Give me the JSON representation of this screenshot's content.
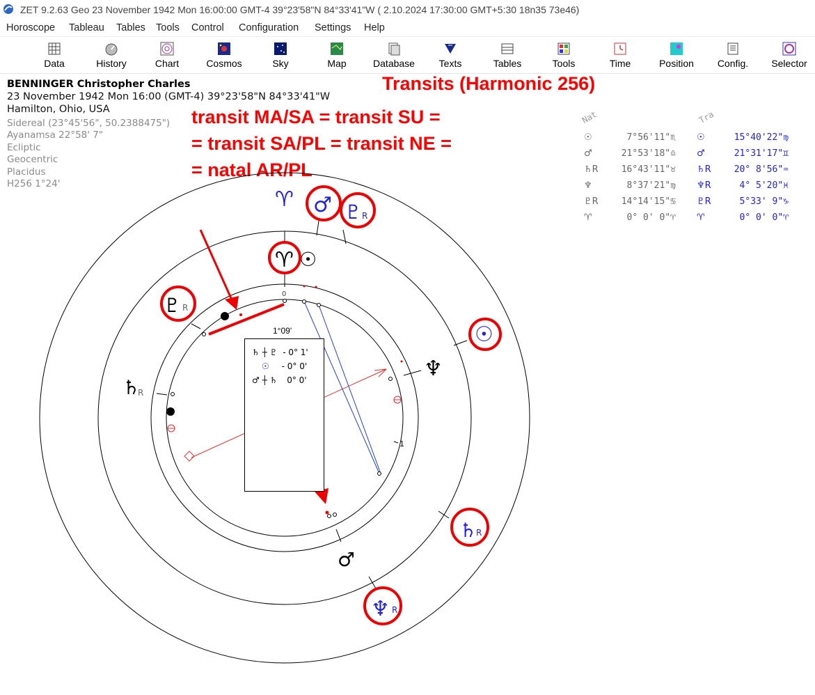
{
  "window": {
    "title": "ZET 9.2.63 Geo   23 November 1942  Mon  16:00:00 GMT-4 39°23'58\"N  84°33'41\"W  ( 2.10.2024  17:30:00 GMT+5:30 18n35 73e46)"
  },
  "menu": [
    "Horoscope",
    "Tableau",
    "Tables",
    "Tools",
    "Control",
    "Configuration",
    "Settings",
    "Help"
  ],
  "toolbar": [
    {
      "label": "Data",
      "icon": "data-icon"
    },
    {
      "label": "History",
      "icon": "history-icon"
    },
    {
      "label": "Chart",
      "icon": "chart-icon"
    },
    {
      "label": "Cosmos",
      "icon": "cosmos-icon"
    },
    {
      "label": "Sky",
      "icon": "sky-icon"
    },
    {
      "label": "Map",
      "icon": "map-icon"
    },
    {
      "label": "Database",
      "icon": "database-icon"
    },
    {
      "label": "Texts",
      "icon": "texts-icon"
    },
    {
      "label": "Tables",
      "icon": "tables-icon"
    },
    {
      "label": "Tools",
      "icon": "tools-icon"
    },
    {
      "label": "Time",
      "icon": "time-icon"
    },
    {
      "label": "Position",
      "icon": "position-icon"
    },
    {
      "label": "Config.",
      "icon": "config-icon"
    },
    {
      "label": "Selector",
      "icon": "selector-icon"
    }
  ],
  "person": {
    "name": "BENNINGER Christopher Charles",
    "datetime": "23 November 1942  Mon  16:00 (GMT-4) 39°23'58\"N  84°33'41\"W",
    "place": "Hamilton, Ohio, USA",
    "settings": [
      "Sidereal (23°45'56\", 50.2388475\")",
      "Ayanamsa 22°58' 7\"",
      "Ecliptic",
      "Geocentric",
      "Placidus",
      "H256   1°24'"
    ]
  },
  "annotations": {
    "title": "Transits (Harmonic 256)",
    "line1": "transit MA/SA = transit SU =",
    "line2": "= transit SA/PL = transit NE =",
    "line3": "= natal AR/PL"
  },
  "positions": {
    "natal_header": "Nat",
    "transit_header": "Tra",
    "rows": [
      {
        "natal_glyph": "☉",
        "natal_value": "7°56'11\"♏",
        "transit_glyph": "☉",
        "transit_value": "15°40'22\"♍"
      },
      {
        "natal_glyph": "♂",
        "natal_value": "21°53'18\"♎",
        "transit_glyph": "♂",
        "transit_value": "21°31'17\"♊"
      },
      {
        "natal_glyph": "♄R",
        "natal_value": "16°43'11\"♉",
        "transit_glyph": "♄R",
        "transit_value": "20° 8'56\"♒"
      },
      {
        "natal_glyph": "♆",
        "natal_value": "8°37'21\"♍",
        "transit_glyph": "♆R",
        "transit_value": "4° 5'20\"♓"
      },
      {
        "natal_glyph": "♇R",
        "natal_value": "14°14'15\"♋",
        "transit_glyph": "♇R",
        "transit_value": "5°33' 9\"♑"
      },
      {
        "natal_glyph": "♈",
        "natal_value": "0° 0' 0\"♈",
        "transit_glyph": "♈",
        "transit_value": "0° 0' 0\"♈"
      }
    ]
  },
  "wheel": {
    "orb_label": "1°09'",
    "aspects": [
      {
        "glyphs": "♄ ┼ ♇",
        "value": "- 0° 1'"
      },
      {
        "glyphs": "☉",
        "value": "- 0° 0'"
      },
      {
        "glyphs": "♂ ┼ ♄",
        "value": "0° 0'"
      }
    ],
    "inner_zero_label": "0",
    "inner_one_label": "1",
    "glyphs": {
      "aries_outer": "♈",
      "mars_outer": "♂",
      "pluto_outer": "♇",
      "pluto_outer_r": "R",
      "sun_outer": "☉",
      "saturn_outer": "♄",
      "saturn_outer_r": "R",
      "neptune_outer": "♆",
      "neptune_outer_r": "R",
      "aries_inner": "♈",
      "sun_inner": "☉",
      "pluto_inner": "♇",
      "pluto_inner_r": "R",
      "saturn_inner": "♄",
      "saturn_inner_r": "R",
      "neptune_inner": "♆",
      "mars_inner": "♂"
    }
  },
  "colors": {
    "annotation": "#ff0000",
    "transit": "#2222dd",
    "natal": "#000000",
    "aspect_red": "#e03030",
    "aspect_blue": "#2040e0"
  }
}
